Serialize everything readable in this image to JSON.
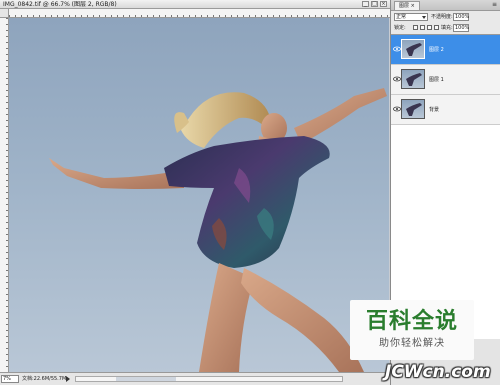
{
  "document": {
    "title": "IMG_0842.tif @ 66.7% (图层 2, RGB/8)",
    "window_buttons": [
      "_",
      "□",
      "×"
    ]
  },
  "status_bar": {
    "zoom": "7%",
    "doc_info": "文档:22.6M/55.7M"
  },
  "layers_panel": {
    "tab": "图层 ×",
    "blend_mode": "正常",
    "opacity_label": "不透明度:",
    "opacity_value": "100%",
    "lock_label": "锁定:",
    "fill_label": "填充:",
    "fill_value": "100%",
    "layers": [
      {
        "name": "图层 2",
        "selected": true,
        "visible": true
      },
      {
        "name": "图层 1",
        "selected": false,
        "visible": true
      },
      {
        "name": "背景",
        "selected": false,
        "visible": true
      }
    ]
  },
  "watermark": {
    "baidu_title": "百科全说",
    "baidu_subtitle": "助你轻松解决",
    "site_logo": "JCWcn.com"
  },
  "colors": {
    "sky_top": "#8ea4bd",
    "selected_layer": "#3d8ee8",
    "baidu_green": "#2a7d2e"
  }
}
